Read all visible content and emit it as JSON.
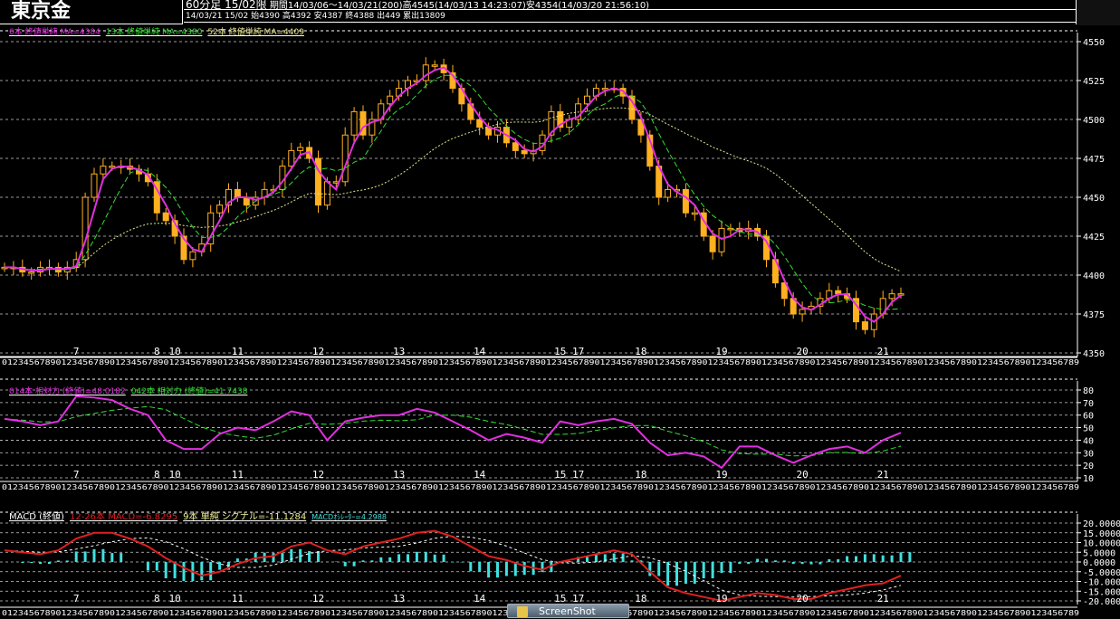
{
  "header": {
    "title": "東京金",
    "period_label": "60分足 15/02限",
    "range_info": "期間14/03/06～14/03/21(200)高4545(14/03/13 14:23:07)安4354(14/03/20 21:56:10)",
    "last_bar": "14/03/21 15/02 始4390 高4392 安4387 終4388 出449 累出13809"
  },
  "legends": {
    "ma6": "6本 終値単純 MA=4384",
    "ma13": "13本 終値単純 MA=4380",
    "ma52": "52本 終値単純 MA=4409",
    "rsi14": "014本 相対力 (終値)=48.0182",
    "rsi42": "042本 相対力 (終値)=41.7438",
    "macd_title": "MACD (終値)",
    "macd": "12-26本 MACD=-6.8295",
    "signal": "9本 単純 シグナル=-11.1284",
    "osc": "MACDｵｼﾚｰﾀｰ=4.2988"
  },
  "colors": {
    "candle": "#ffb020",
    "ma6": "#e030e0",
    "ma13": "#30e030",
    "ma52": "#e8e890",
    "rsi14": "#e030e0",
    "rsi42": "#30e030",
    "macd": "#e02020",
    "signal": "#ffffff",
    "osc": "#40e0e0"
  },
  "taskbar": {
    "button": "ScreenShot"
  },
  "chart_data": [
    {
      "type": "candlestick",
      "ylim": [
        4350,
        4550
      ],
      "yticks": [
        "4550",
        "4525",
        "4500",
        "4475",
        "4450",
        "4425",
        "4400",
        "4375",
        "4350"
      ],
      "date_ticks": [
        {
          "label": "7",
          "i": 8
        },
        {
          "label": "8",
          "i": 17
        },
        {
          "label": "10",
          "i": 19
        },
        {
          "label": "11",
          "i": 26
        },
        {
          "label": "12",
          "i": 35
        },
        {
          "label": "13",
          "i": 44
        },
        {
          "label": "14",
          "i": 53
        },
        {
          "label": "15",
          "i": 62
        },
        {
          "label": "17",
          "i": 64
        },
        {
          "label": "18",
          "i": 71
        },
        {
          "label": "19",
          "i": 80
        },
        {
          "label": "20",
          "i": 89
        },
        {
          "label": "21",
          "i": 98
        }
      ],
      "hour_ticks_text": "0123456789",
      "close": [
        4405,
        4405,
        4402,
        4402,
        4405,
        4405,
        4402,
        4405,
        4410,
        4450,
        4465,
        4470,
        4470,
        4470,
        4468,
        4465,
        4460,
        4440,
        4435,
        4425,
        4410,
        4415,
        4420,
        4440,
        4445,
        4455,
        4450,
        4445,
        4450,
        4455,
        4455,
        4470,
        4480,
        4482,
        4475,
        4445,
        4460,
        4460,
        4490,
        4505,
        4490,
        4500,
        4510,
        4515,
        4520,
        4525,
        4525,
        4535,
        4535,
        4530,
        4520,
        4510,
        4500,
        4495,
        4490,
        4495,
        4485,
        4480,
        4478,
        4480,
        4490,
        4505,
        4495,
        4500,
        4510,
        4515,
        4520,
        4520,
        4520,
        4515,
        4500,
        4490,
        4470,
        4450,
        4455,
        4455,
        4440,
        4440,
        4425,
        4415,
        4430,
        4430,
        4428,
        4430,
        4425,
        4410,
        4395,
        4385,
        4375,
        4378,
        4380,
        4385,
        4390,
        4388,
        4385,
        4370,
        4365,
        4375,
        4385,
        4388,
        4388
      ]
    },
    {
      "type": "line",
      "ylim": [
        10,
        80
      ],
      "yticks": [
        "80",
        "70",
        "60",
        "50",
        "40",
        "30",
        "20",
        "10"
      ],
      "series": [
        {
          "name": "014本 相対力",
          "values": [
            57,
            55,
            52,
            55,
            75,
            74,
            72,
            65,
            60,
            40,
            33,
            33,
            45,
            50,
            48,
            55,
            63,
            60,
            40,
            55,
            58,
            60,
            60,
            65,
            62,
            55,
            48,
            40,
            45,
            42,
            38,
            55,
            52,
            55,
            57,
            53,
            38,
            28,
            30,
            27,
            18,
            35,
            35,
            28,
            22,
            28,
            33,
            35,
            30,
            40,
            46
          ]
        }
      ]
    },
    {
      "type": "line",
      "ylim": [
        -20,
        20
      ],
      "yticks": [
        "20.0000",
        "15.0000",
        "10.0000",
        "5.0000",
        "0.0000",
        "-5.0000",
        "-10.0000",
        "-15.0000",
        "-20.0000"
      ],
      "series": [
        {
          "name": "12-26本 MACD",
          "values": [
            6,
            5,
            4,
            6,
            12,
            15,
            15,
            12,
            8,
            2,
            -3,
            -7,
            -5,
            -1,
            2,
            3,
            8,
            10,
            6,
            4,
            8,
            10,
            12,
            15,
            16,
            13,
            8,
            3,
            1,
            -2,
            -4,
            0,
            2,
            4,
            6,
            4,
            -5,
            -13,
            -16,
            -18,
            -20,
            -18,
            -16,
            -17,
            -19,
            -19,
            -16,
            -14,
            -12,
            -11,
            -7
          ]
        }
      ]
    }
  ]
}
